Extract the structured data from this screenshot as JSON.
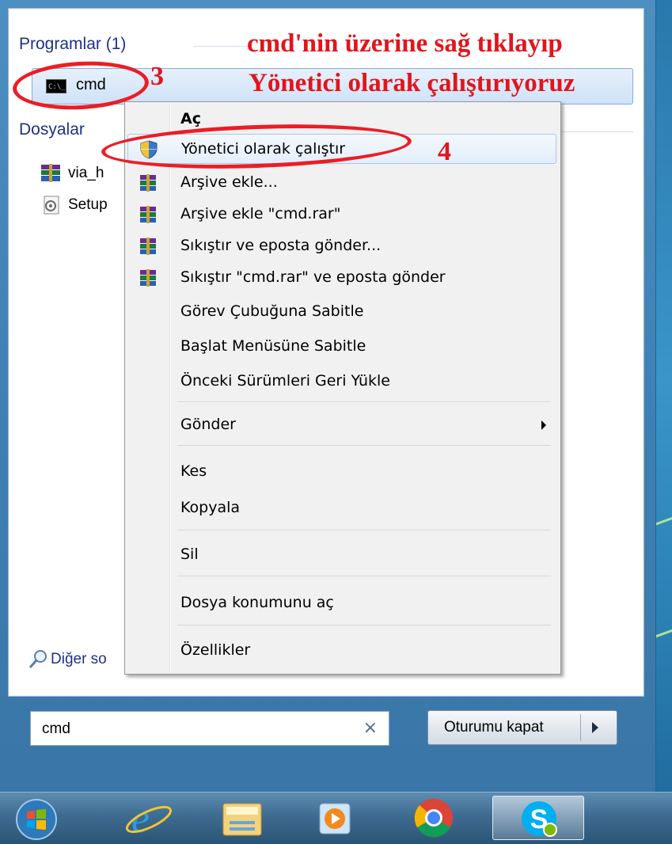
{
  "annotations": {
    "line1": "cmd'nin üzerine sağ tıklayıp",
    "line2": "Yönetici olarak çalıştırıyoruz",
    "step3": "3",
    "step4": "4"
  },
  "start_menu": {
    "programs_header": "Programlar (1)",
    "program_item": "cmd",
    "files_header": "Dosyalar",
    "files": [
      {
        "label": "via_h",
        "icon": "winrar-archive-icon"
      },
      {
        "label": "Setup",
        "icon": "setup-file-icon"
      }
    ],
    "see_more": "Diğer so",
    "search": {
      "value": "cmd",
      "clear_glyph": "×"
    },
    "shutdown_label": "Oturumu kapat"
  },
  "context_menu": {
    "items": [
      {
        "label": "Aç",
        "bold": true
      },
      {
        "label": "Yönetici olarak çalıştır",
        "icon": "uac-shield-icon",
        "highlighted": true
      },
      {
        "label": "Arşive ekle...",
        "icon": "winrar-icon"
      },
      {
        "label": "Arşive ekle \"cmd.rar\"",
        "icon": "winrar-icon"
      },
      {
        "label": "Sıkıştır ve eposta gönder...",
        "icon": "winrar-icon"
      },
      {
        "label": "Sıkıştır \"cmd.rar\" ve eposta gönder",
        "icon": "winrar-icon"
      },
      {
        "label": "Görev Çubuğuna Sabitle"
      },
      {
        "label": "Başlat Menüsüne Sabitle"
      },
      {
        "label": "Önceki Sürümleri Geri Yükle"
      },
      {
        "label": "Gönder",
        "submenu": true
      },
      {
        "label": "Kes"
      },
      {
        "label": "Kopyala"
      },
      {
        "label": "Sil"
      },
      {
        "label": "Dosya konumunu aç"
      },
      {
        "label": "Özellikler"
      }
    ]
  },
  "taskbar": {
    "items": [
      "start-orb-icon",
      "internet-explorer-icon",
      "windows-explorer-icon",
      "media-player-icon",
      "chrome-icon",
      "skype-icon"
    ]
  },
  "colors": {
    "annotation_red": "#e1151c",
    "header_blue": "#1e3287"
  }
}
